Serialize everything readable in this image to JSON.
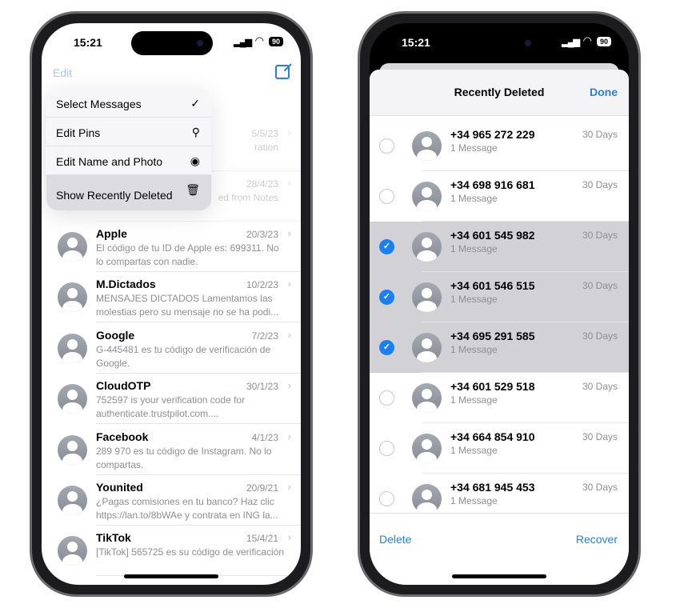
{
  "left_phone": {
    "status": {
      "time": "15:21",
      "battery": "90"
    },
    "nav": {
      "edit_label": "Edit",
      "compose_icon": "compose-icon"
    },
    "menu": [
      {
        "label": "Select Messages",
        "icon": "✓"
      },
      {
        "label": "Edit Pins",
        "icon": "⚲"
      },
      {
        "label": "Edit Name and Photo",
        "icon": "◉"
      },
      {
        "label": "Show Recently Deleted",
        "icon": "🗑"
      }
    ],
    "conversations": [
      {
        "name": "",
        "date": "5/5/23",
        "preview": "ration"
      },
      {
        "name": "",
        "date": "28/4/23",
        "preview": "ed from Notes"
      },
      {
        "name": "Apple",
        "date": "20/3/23",
        "preview": "El código de tu ID de Apple es: 699311. No lo compartas con nadie."
      },
      {
        "name": "M.Dictados",
        "date": "10/2/23",
        "preview": "MENSAJES DICTADOS Lamentamos las molestias pero su mensaje no se ha podi..."
      },
      {
        "name": "Google",
        "date": "7/2/23",
        "preview": "G-445481 es tu código de verificación de Google."
      },
      {
        "name": "CloudOTP",
        "date": "30/1/23",
        "preview": "752597 is your verification code for authenticate.trustpilot.com...."
      },
      {
        "name": "Facebook",
        "date": "4/1/23",
        "preview": "289 970 es tu código de Instagram. No lo compartas."
      },
      {
        "name": "Younited",
        "date": "20/9/21",
        "preview": "¿Pagas comisiones en tu banco? Haz clic https://lan.to/8bWAe y contrata en ING la..."
      },
      {
        "name": "TikTok",
        "date": "15/4/21",
        "preview": "[TikTok] 565725 es su código de verificación"
      }
    ]
  },
  "right_phone": {
    "status": {
      "time": "15:21",
      "battery": "90"
    },
    "header": {
      "title": "Recently Deleted",
      "done_label": "Done"
    },
    "items": [
      {
        "number": "+34 965 272 229",
        "count": "1 Message",
        "days": "30 Days",
        "selected": false
      },
      {
        "number": "+34 698 916 681",
        "count": "1 Message",
        "days": "30 Days",
        "selected": false
      },
      {
        "number": "+34 601 545 982",
        "count": "1 Message",
        "days": "30 Days",
        "selected": true
      },
      {
        "number": "+34 601 546 515",
        "count": "1 Message",
        "days": "30 Days",
        "selected": true
      },
      {
        "number": "+34 695 291 585",
        "count": "1 Message",
        "days": "30 Days",
        "selected": true
      },
      {
        "number": "+34 601 529 518",
        "count": "1 Message",
        "days": "30 Days",
        "selected": false
      },
      {
        "number": "+34 664 854 910",
        "count": "1 Message",
        "days": "30 Days",
        "selected": false
      },
      {
        "number": "+34 681 945 453",
        "count": "1 Message",
        "days": "30 Days",
        "selected": false
      }
    ],
    "toolbar": {
      "delete_label": "Delete",
      "recover_label": "Recover"
    }
  },
  "colors": {
    "accent": "#2a7fe0",
    "selected_row": "#d1d1d6",
    "checkbox": "#1a7ff0"
  }
}
